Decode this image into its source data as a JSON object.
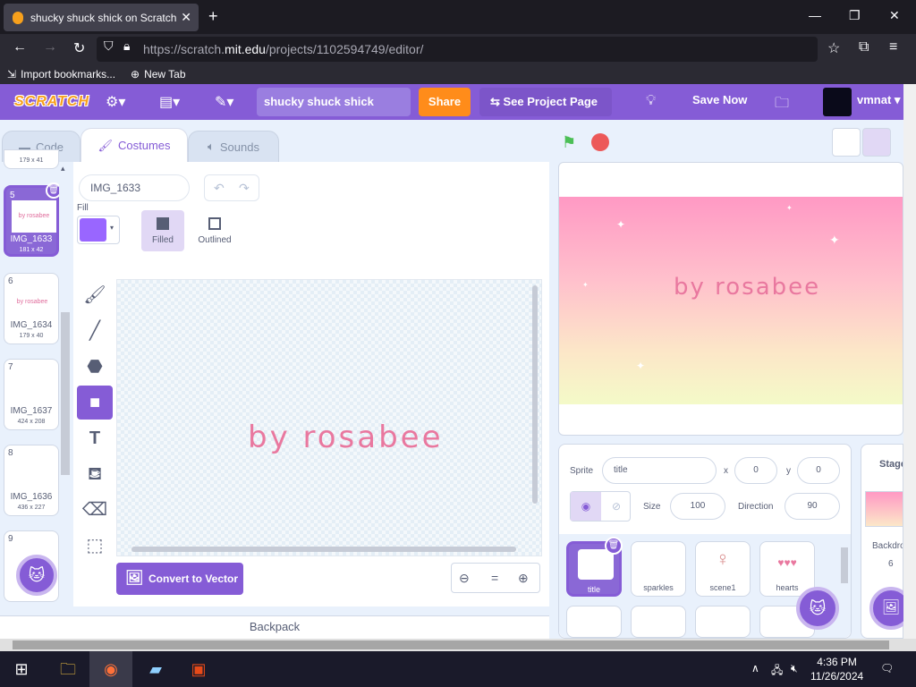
{
  "browser": {
    "tab_title": "shucky shuck shick on Scratch",
    "url_prefix": "https://scratch.",
    "url_domain": "mit.edu",
    "url_path": "/projects/1102594749/editor/",
    "bookmarks": [
      "Import bookmarks...",
      "New Tab"
    ]
  },
  "menubar": {
    "logo": "SCRATCH",
    "project_title": "shucky shuck shick",
    "share": "Share",
    "see_project": "See Project Page",
    "save_now": "Save Now",
    "username": "vmnat"
  },
  "editor_tabs": [
    "Code",
    "Costumes",
    "Sounds"
  ],
  "costumes": [
    {
      "num": "5",
      "name": "IMG_1633",
      "dims": "181 x 42",
      "thumb": "by rosabee",
      "selected": true
    },
    {
      "num": "6",
      "name": "IMG_1634",
      "dims": "179 x 40",
      "thumb": "by rosabee",
      "selected": false
    },
    {
      "num": "7",
      "name": "IMG_1637",
      "dims": "424 x 208",
      "thumb": "",
      "selected": false
    },
    {
      "num": "8",
      "name": "IMG_1636",
      "dims": "436 x 227",
      "thumb": "",
      "selected": false
    },
    {
      "num": "9",
      "name": "",
      "dims": "",
      "thumb": "",
      "selected": false
    }
  ],
  "costume_partial_dims": "179 x 41",
  "paint": {
    "costume_name": "IMG_1633",
    "fill_label": "Fill",
    "fill_color": "#9966ff",
    "filled": "Filled",
    "outlined": "Outlined",
    "canvas_text": "by rosabee",
    "convert": "Convert to Vector",
    "zoom_reset": "="
  },
  "backpack": "Backpack",
  "stage": {
    "text": "by rosabee"
  },
  "sprite": {
    "label": "Sprite",
    "name": "title",
    "x_label": "x",
    "x": "0",
    "y_label": "y",
    "y": "0",
    "size_label": "Size",
    "size": "100",
    "direction_label": "Direction",
    "direction": "90",
    "sprites": [
      "title",
      "sparkles",
      "scene1",
      "hearts"
    ]
  },
  "stage_pane": {
    "header": "Stage",
    "backdrops_label": "Backdro",
    "backdrops_count": "6"
  },
  "taskbar": {
    "time": "4:36 PM",
    "date": "11/26/2024"
  },
  "colors": {
    "scratch_purple": "#855cd6",
    "share_orange": "#ff8c1a",
    "text_pink": "#e9789f"
  }
}
